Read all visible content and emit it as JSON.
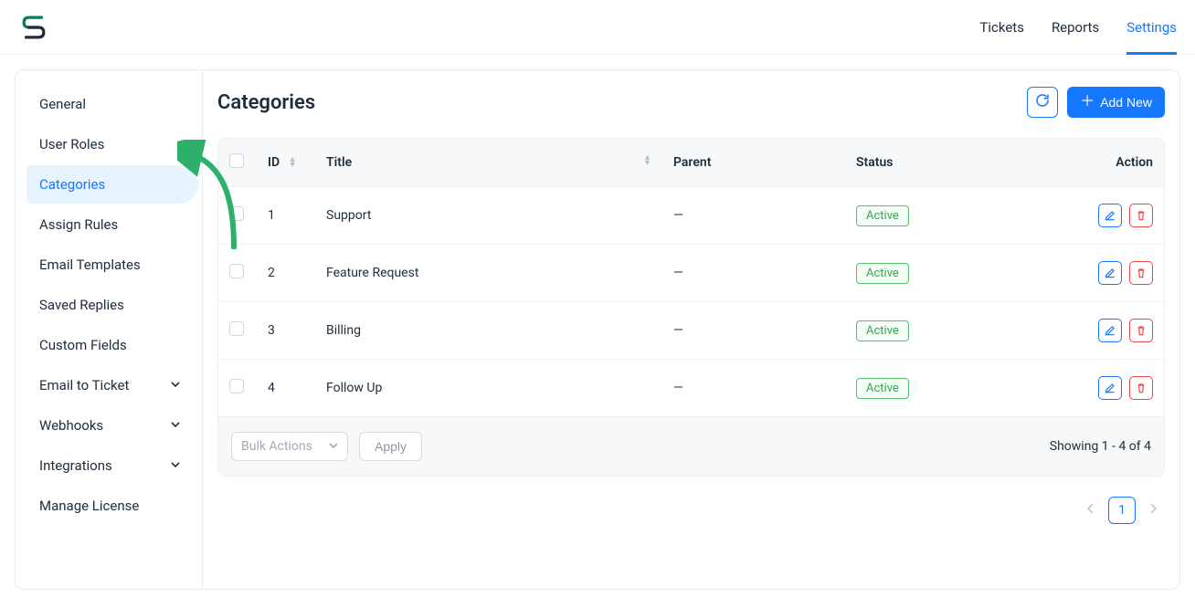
{
  "nav": {
    "tickets": "Tickets",
    "reports": "Reports",
    "settings": "Settings"
  },
  "sidebar": {
    "items": [
      {
        "label": "General"
      },
      {
        "label": "User Roles"
      },
      {
        "label": "Categories"
      },
      {
        "label": "Assign Rules"
      },
      {
        "label": "Email Templates"
      },
      {
        "label": "Saved Replies"
      },
      {
        "label": "Custom Fields"
      },
      {
        "label": "Email to Ticket"
      },
      {
        "label": "Webhooks"
      },
      {
        "label": "Integrations"
      },
      {
        "label": "Manage License"
      }
    ]
  },
  "header": {
    "title": "Categories",
    "add_new": "Add New"
  },
  "table": {
    "headers": {
      "id": "ID",
      "title": "Title",
      "parent": "Parent",
      "status": "Status",
      "action": "Action"
    },
    "rows": [
      {
        "id": "1",
        "title": "Support",
        "parent": "—",
        "status": "Active"
      },
      {
        "id": "2",
        "title": "Feature Request",
        "parent": "—",
        "status": "Active"
      },
      {
        "id": "3",
        "title": "Billing",
        "parent": "—",
        "status": "Active"
      },
      {
        "id": "4",
        "title": "Follow Up",
        "parent": "—",
        "status": "Active"
      }
    ]
  },
  "footer": {
    "bulk_label": "Bulk Actions",
    "apply": "Apply",
    "showing": "Showing 1 - 4 of 4"
  },
  "pagination": {
    "page": "1"
  }
}
